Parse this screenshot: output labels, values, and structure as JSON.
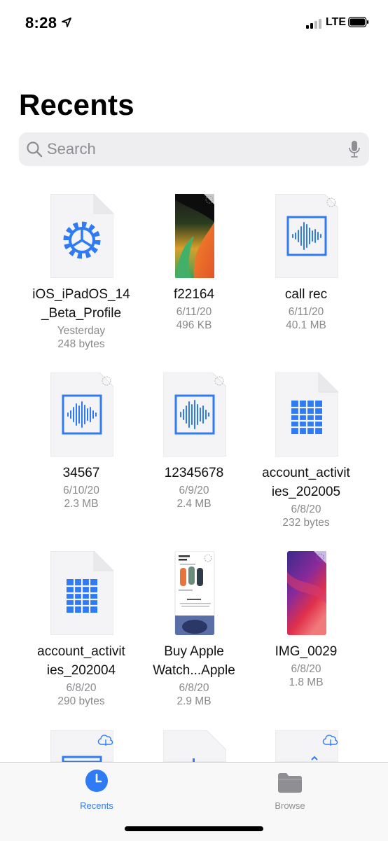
{
  "status_bar": {
    "time": "8:28",
    "network": "LTE"
  },
  "title": "Recents",
  "search": {
    "placeholder": "Search"
  },
  "files": [
    {
      "name_lines": [
        "iOS_iPadOS_14",
        "_Beta_Profile"
      ],
      "date": "Yesterday",
      "size": "248 bytes",
      "icon": "settings-gear-icon"
    },
    {
      "name_lines": [
        "f22164"
      ],
      "date": "6/11/20",
      "size": "496 KB",
      "icon": "wallpaper-thumbnail"
    },
    {
      "name_lines": [
        "call rec"
      ],
      "date": "6/11/20",
      "size": "40.1 MB",
      "icon": "audio-waveform-icon"
    },
    {
      "name_lines": [
        "34567"
      ],
      "date": "6/10/20",
      "size": "2.3 MB",
      "icon": "audio-waveform-icon"
    },
    {
      "name_lines": [
        "12345678"
      ],
      "date": "6/9/20",
      "size": "2.4 MB",
      "icon": "audio-waveform-icon"
    },
    {
      "name_lines": [
        "account_activit",
        "ies_202005"
      ],
      "date": "6/8/20",
      "size": "232 bytes",
      "icon": "spreadsheet-icon"
    },
    {
      "name_lines": [
        "account_activit",
        "ies_202004"
      ],
      "date": "6/8/20",
      "size": "290 bytes",
      "icon": "spreadsheet-icon"
    },
    {
      "name_lines": [
        "Buy Apple",
        "Watch...Apple"
      ],
      "date": "6/8/20",
      "size": "2.9 MB",
      "icon": "webpage-thumbnail"
    },
    {
      "name_lines": [
        "IMG_0029"
      ],
      "date": "6/8/20",
      "size": "1.8 MB",
      "icon": "image-thumbnail"
    }
  ],
  "tabs": [
    {
      "label": "Recents",
      "icon": "clock-icon",
      "active": true
    },
    {
      "label": "Browse",
      "icon": "folder-icon",
      "active": false
    }
  ],
  "colors": {
    "accent": "#2f7bf5",
    "inactive": "#8e8e93",
    "doc_bg": "#f4f4f6"
  }
}
